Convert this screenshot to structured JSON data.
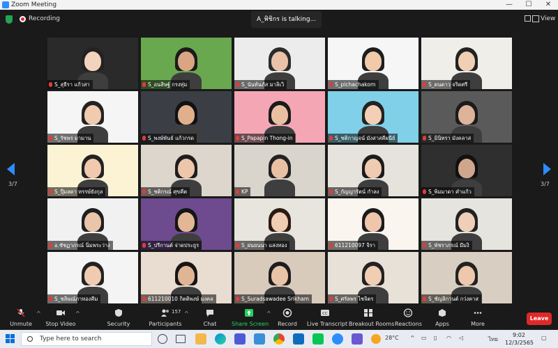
{
  "window": {
    "title": "Zoom Meeting"
  },
  "topbar": {
    "recording": "Recording",
    "talking": "A_พิชิกร is talking...",
    "view": "View"
  },
  "nav": {
    "page_left": "3/7",
    "page_right": "3/7"
  },
  "tiles": [
    {
      "name": "S_สุธีรา แก้วสา"
    },
    {
      "name": "S_อนสิษฐ์ กรงทุ่ม"
    },
    {
      "name": "S_นันท์นภัส มาลิเวิ"
    },
    {
      "name": "S_pichachakorn"
    },
    {
      "name": "S_ดนดาว จริดศรี"
    },
    {
      "name": "S_รัชพร มามาน"
    },
    {
      "name": "S_พงษ์พันธ์ แก้วกรด"
    },
    {
      "name": "S_Papapin Thong-in"
    },
    {
      "name": "S_ชติกาญจน์ มังสาสคีผนีย์"
    },
    {
      "name": "S_มินิทรา มังคลาส"
    },
    {
      "name": "S_ปุ๊มลดา หรรษ์ยังกุล"
    },
    {
      "name": "S_ชติกรณ์ ศุขคีต"
    },
    {
      "name": "KP"
    },
    {
      "name": "S_กัญญารัตน์ กำลง"
    },
    {
      "name": "S_พิมมาดา คำแก้ว"
    },
    {
      "name": "อ.ชัชฏาภรณ์ นิ่มพระว่าง"
    },
    {
      "name": "S_ปรีกานต์ จ่าดประยูร"
    },
    {
      "name": "S_ฝนยนนา แสงทอง"
    },
    {
      "name": "611210097 จิรา"
    },
    {
      "name": "S_พัชราภรณ์ มีมงิ"
    },
    {
      "name": "S_ชลิษณ์ภาหองคีม"
    },
    {
      "name": "611210010 กิตติพงษ์ มงคล"
    },
    {
      "name": "S_Suradsawadee Srikham"
    },
    {
      "name": "S_ศรัลพร ไชจิตร"
    },
    {
      "name": "S_ชัญลิกานต์ กว่งคาส"
    }
  ],
  "toolbar": {
    "unmute": "Unmute",
    "stop_video": "Stop Video",
    "security": "Security",
    "participants": "Participants",
    "participants_count": "157",
    "chat": "Chat",
    "share_screen": "Share Screen",
    "record": "Record",
    "live_transcript": "Live Transcript",
    "breakout_rooms": "Breakout Rooms",
    "reactions": "Reactions",
    "apps": "Apps",
    "more": "More",
    "leave": "Leave"
  },
  "taskbar": {
    "search_placeholder": "Type here to search",
    "temperature": "28°C",
    "language": "ไทย",
    "time": "9:02",
    "date": "12/3/2565"
  },
  "colors": {
    "share_green": "#23d160",
    "leave_red": "#e02828",
    "accent_blue": "#2d8cff"
  }
}
